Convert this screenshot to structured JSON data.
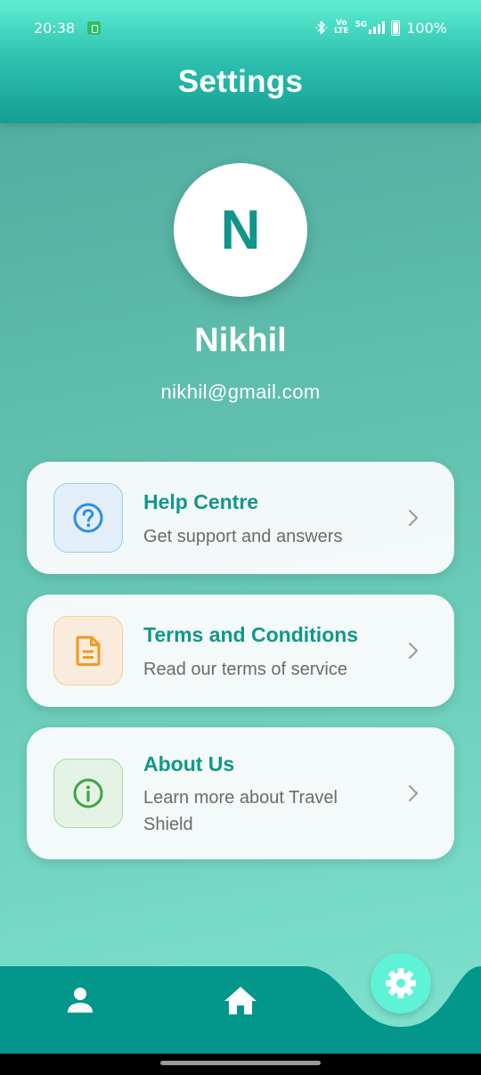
{
  "status_bar": {
    "time": "20:38",
    "network_top": "Vo",
    "network_bottom": "LTE",
    "network_5g": "5G",
    "battery": "100%"
  },
  "header": {
    "title": "Settings"
  },
  "profile": {
    "initial": "N",
    "name": "Nikhil",
    "email": "nikhil@gmail.com"
  },
  "menu": [
    {
      "title": "Help Centre",
      "subtitle": "Get support and answers",
      "icon": "help-circle-icon",
      "color": "#2f8fde",
      "bg": "#e2eef8",
      "border": "#9fcdf0"
    },
    {
      "title": "Terms and Conditions",
      "subtitle": "Read our terms of service",
      "icon": "document-icon",
      "color": "#f39a1e",
      "bg": "#f9ecdd",
      "border": "#f4cf95"
    },
    {
      "title": "About Us",
      "subtitle": "Learn more about Travel Shield",
      "icon": "info-icon",
      "color": "#3fa548",
      "bg": "#e5f2e6",
      "border": "#a9d9ad"
    }
  ],
  "bottom_nav": {
    "items": [
      {
        "name": "profile",
        "icon": "person-icon"
      },
      {
        "name": "home",
        "icon": "home-icon"
      },
      {
        "name": "settings",
        "icon": "gear-icon",
        "active": true
      }
    ]
  },
  "colors": {
    "accent": "#0f9688",
    "nav": "#03968a",
    "fab": "#5ef2d6"
  }
}
